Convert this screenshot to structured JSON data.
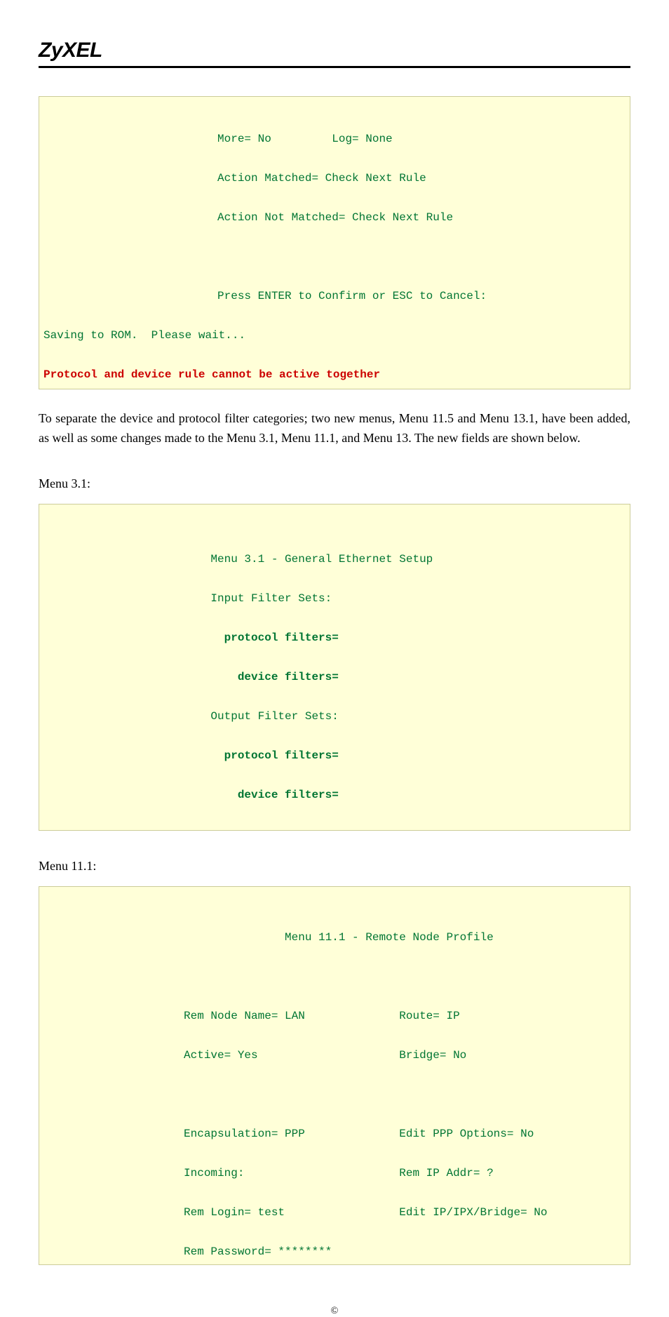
{
  "brand": "ZyXEL",
  "block1": {
    "l1": "          More= No         Log= None",
    "l2": "          Action Matched= Check Next Rule",
    "l3": "          Action Not Matched= Check Next Rule",
    "l4": "          Press ENTER to Confirm or ESC to Cancel:",
    "l5": "Saving to ROM.  Please wait...",
    "l6": "Protocol and device rule cannot be active together"
  },
  "para1": "To separate the device and protocol filter categories; two new menus, Menu 11.5 and Menu 13.1, have been added, as well as some changes made to the Menu 3.1, Menu 11.1, and Menu 13. The new fields are shown below.",
  "label1": "Menu 3.1:",
  "block2": {
    "l1": "         Menu 3.1 - General Ethernet Setup",
    "l2": "         Input Filter Sets:",
    "l3": "           protocol filters=",
    "l4": "             device filters=",
    "l5": "         Output Filter Sets:",
    "l6": "           protocol filters=",
    "l7": "             device filters="
  },
  "label2": "Menu 11.1:",
  "block3": {
    "l1": "                    Menu 11.1 - Remote Node Profile",
    "l2": "     Rem Node Name= LAN              Route= IP",
    "l3": "     Active= Yes                     Bridge= No",
    "l4": "     Encapsulation= PPP              Edit PPP Options= No",
    "l5": "     Incoming:                       Rem IP Addr= ?",
    "l6": "     Rem Login= test                 Edit IP/IPX/Bridge= No",
    "l7": "     Rem Password= ********"
  },
  "footer": "©"
}
